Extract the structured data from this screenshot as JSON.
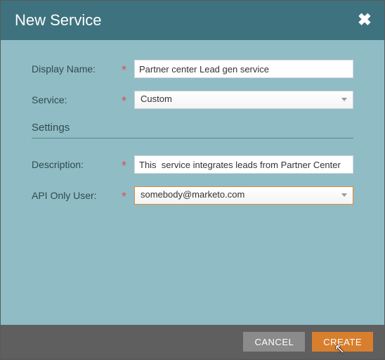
{
  "dialog": {
    "title": "New Service",
    "close_label": "✖"
  },
  "form": {
    "display_name": {
      "label": "Display Name:",
      "value": "Partner center Lead gen service"
    },
    "service": {
      "label": "Service:",
      "value": "Custom"
    },
    "settings_heading": "Settings",
    "description": {
      "label": "Description:",
      "value": "This  service integrates leads from Partner Center"
    },
    "api_only_user": {
      "label": "API Only User:",
      "value": "somebody@marketo.com"
    }
  },
  "footer": {
    "cancel": "CANCEL",
    "create": "CREATE"
  }
}
